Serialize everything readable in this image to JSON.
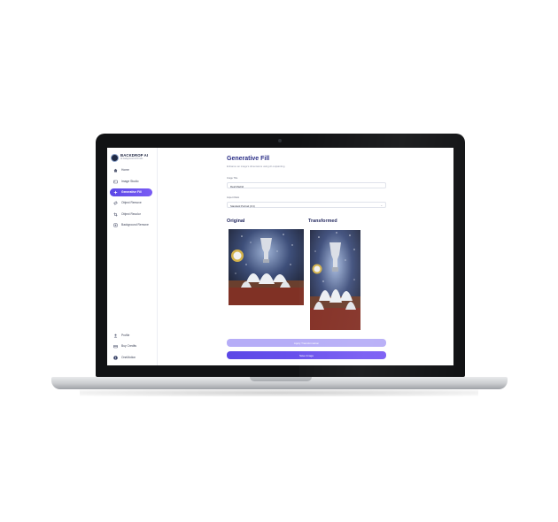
{
  "brand": {
    "name": "BACKDROP AI",
    "tagline": "AI background & fill tools"
  },
  "sidebar": {
    "nav": [
      {
        "label": "Home",
        "icon": "home-icon"
      },
      {
        "label": "Image Studio",
        "icon": "image-icon"
      },
      {
        "label": "Generative Fill",
        "icon": "sparkle-icon",
        "active": true
      },
      {
        "label": "Object Remove",
        "icon": "eraser-icon"
      },
      {
        "label": "Object Recolor",
        "icon": "crop-icon"
      },
      {
        "label": "Background Remove",
        "icon": "layers-icon"
      }
    ],
    "bottom": [
      {
        "label": "Profile",
        "icon": "user-icon"
      },
      {
        "label": "Buy Credits",
        "icon": "credit-card-icon"
      },
      {
        "label": "OneMotion",
        "icon": "avatar"
      }
    ]
  },
  "page": {
    "title": "Generative Fill",
    "subtitle": "Enhance an image's dimensions using AI outpainting"
  },
  "form": {
    "image_title_label": "Image Title",
    "image_title_value": "Real Madrid",
    "aspect_label": "Aspect Ratio",
    "aspect_value": "Standard Portrait (3:4)"
  },
  "preview": {
    "original_label": "Original",
    "transformed_label": "Transformed"
  },
  "buttons": {
    "apply": "Apply Transformation",
    "save": "Save Image"
  },
  "colors": {
    "accent": "#6a52f0",
    "accent_light": "#b6adf7",
    "title": "#2b2f87"
  }
}
